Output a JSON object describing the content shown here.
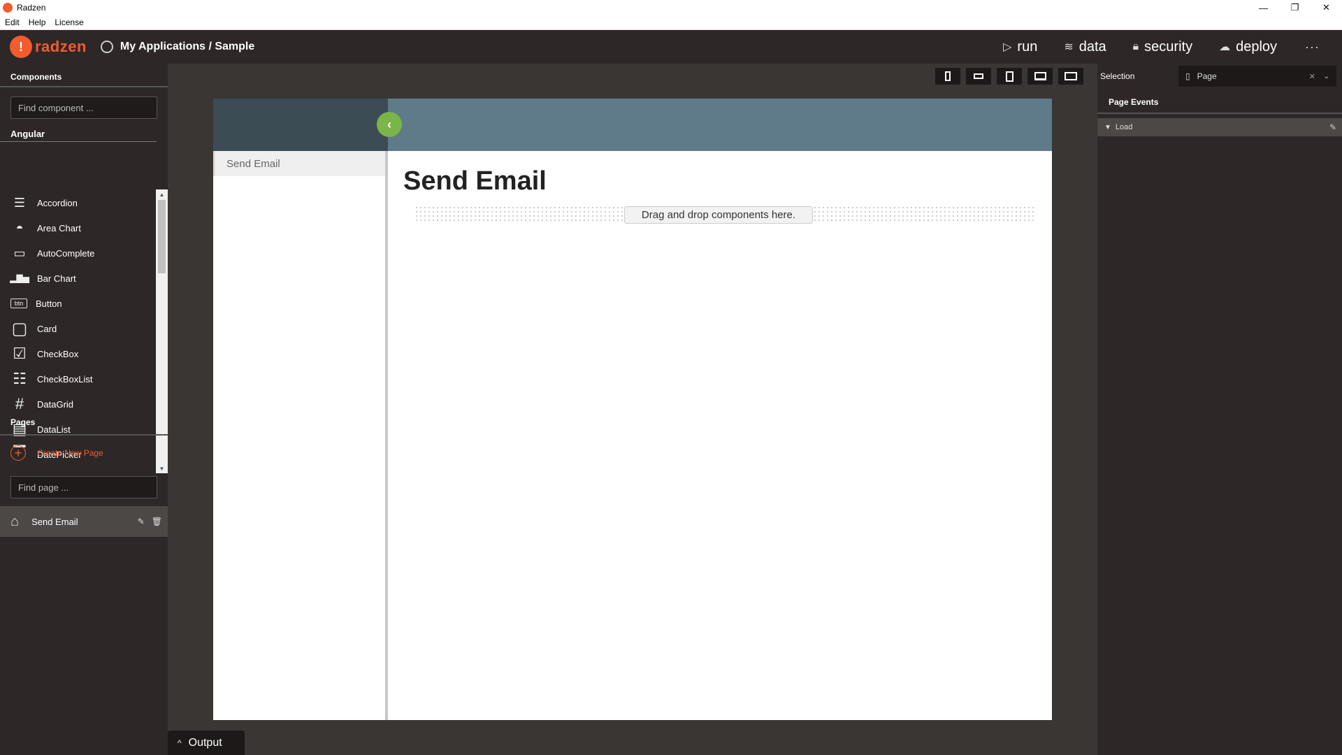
{
  "window": {
    "title": "Radzen",
    "controls": {
      "minimize": "—",
      "restore": "❐",
      "close": "✕"
    }
  },
  "menu": [
    "Edit",
    "Help",
    "License"
  ],
  "header": {
    "logo_mark": "!",
    "logo_text": "radzen",
    "path": "My Applications / Sample",
    "actions": [
      {
        "icon": "▷",
        "label": "run"
      },
      {
        "icon": "≋",
        "label": "data"
      },
      {
        "icon": "🔒︎",
        "label": "security"
      },
      {
        "icon": "☁︎",
        "label": "deploy"
      }
    ],
    "more": "···"
  },
  "components": {
    "title": "Components",
    "search_placeholder": "Find component ...",
    "group": "Angular",
    "items": [
      {
        "icon": "accordion-icon",
        "glyph": "☰",
        "label": "Accordion"
      },
      {
        "icon": "area-chart-icon",
        "glyph": "◓",
        "label": "Area Chart"
      },
      {
        "icon": "autocomplete-icon",
        "glyph": "▭",
        "label": "AutoComplete"
      },
      {
        "icon": "bar-chart-icon",
        "glyph": "▂▇▅",
        "label": "Bar Chart"
      },
      {
        "icon": "button-icon",
        "glyph": "btn",
        "label": "Button"
      },
      {
        "icon": "card-icon",
        "glyph": "▢",
        "label": "Card"
      },
      {
        "icon": "checkbox-icon",
        "glyph": "☑",
        "label": "CheckBox"
      },
      {
        "icon": "checkboxlist-icon",
        "glyph": "☷",
        "label": "CheckBoxList"
      },
      {
        "icon": "datagrid-icon",
        "glyph": "#",
        "label": "DataGrid"
      },
      {
        "icon": "datalist-icon",
        "glyph": "▤",
        "label": "DataList"
      },
      {
        "icon": "datepicker-icon",
        "glyph": "▔",
        "label": "DatePicker"
      }
    ]
  },
  "pages": {
    "title": "Pages",
    "create_label": "Create New Page",
    "search_placeholder": "Find page ...",
    "items": [
      {
        "label": "Send Email"
      }
    ]
  },
  "canvas": {
    "nav_item": "Send Email",
    "heading": "Send Email",
    "dropzone": "Drag and drop components here.",
    "toggle": "‹",
    "output_label": "Output"
  },
  "selection": {
    "label": "Selection",
    "value": "Page",
    "events_title": "Page Events",
    "events": [
      {
        "label": "Load"
      }
    ]
  },
  "colors": {
    "accent": "#f25c2e",
    "header_bar": "#5f7b8a",
    "sidebar_head": "#3b4c55",
    "toggle": "#7ab547"
  }
}
